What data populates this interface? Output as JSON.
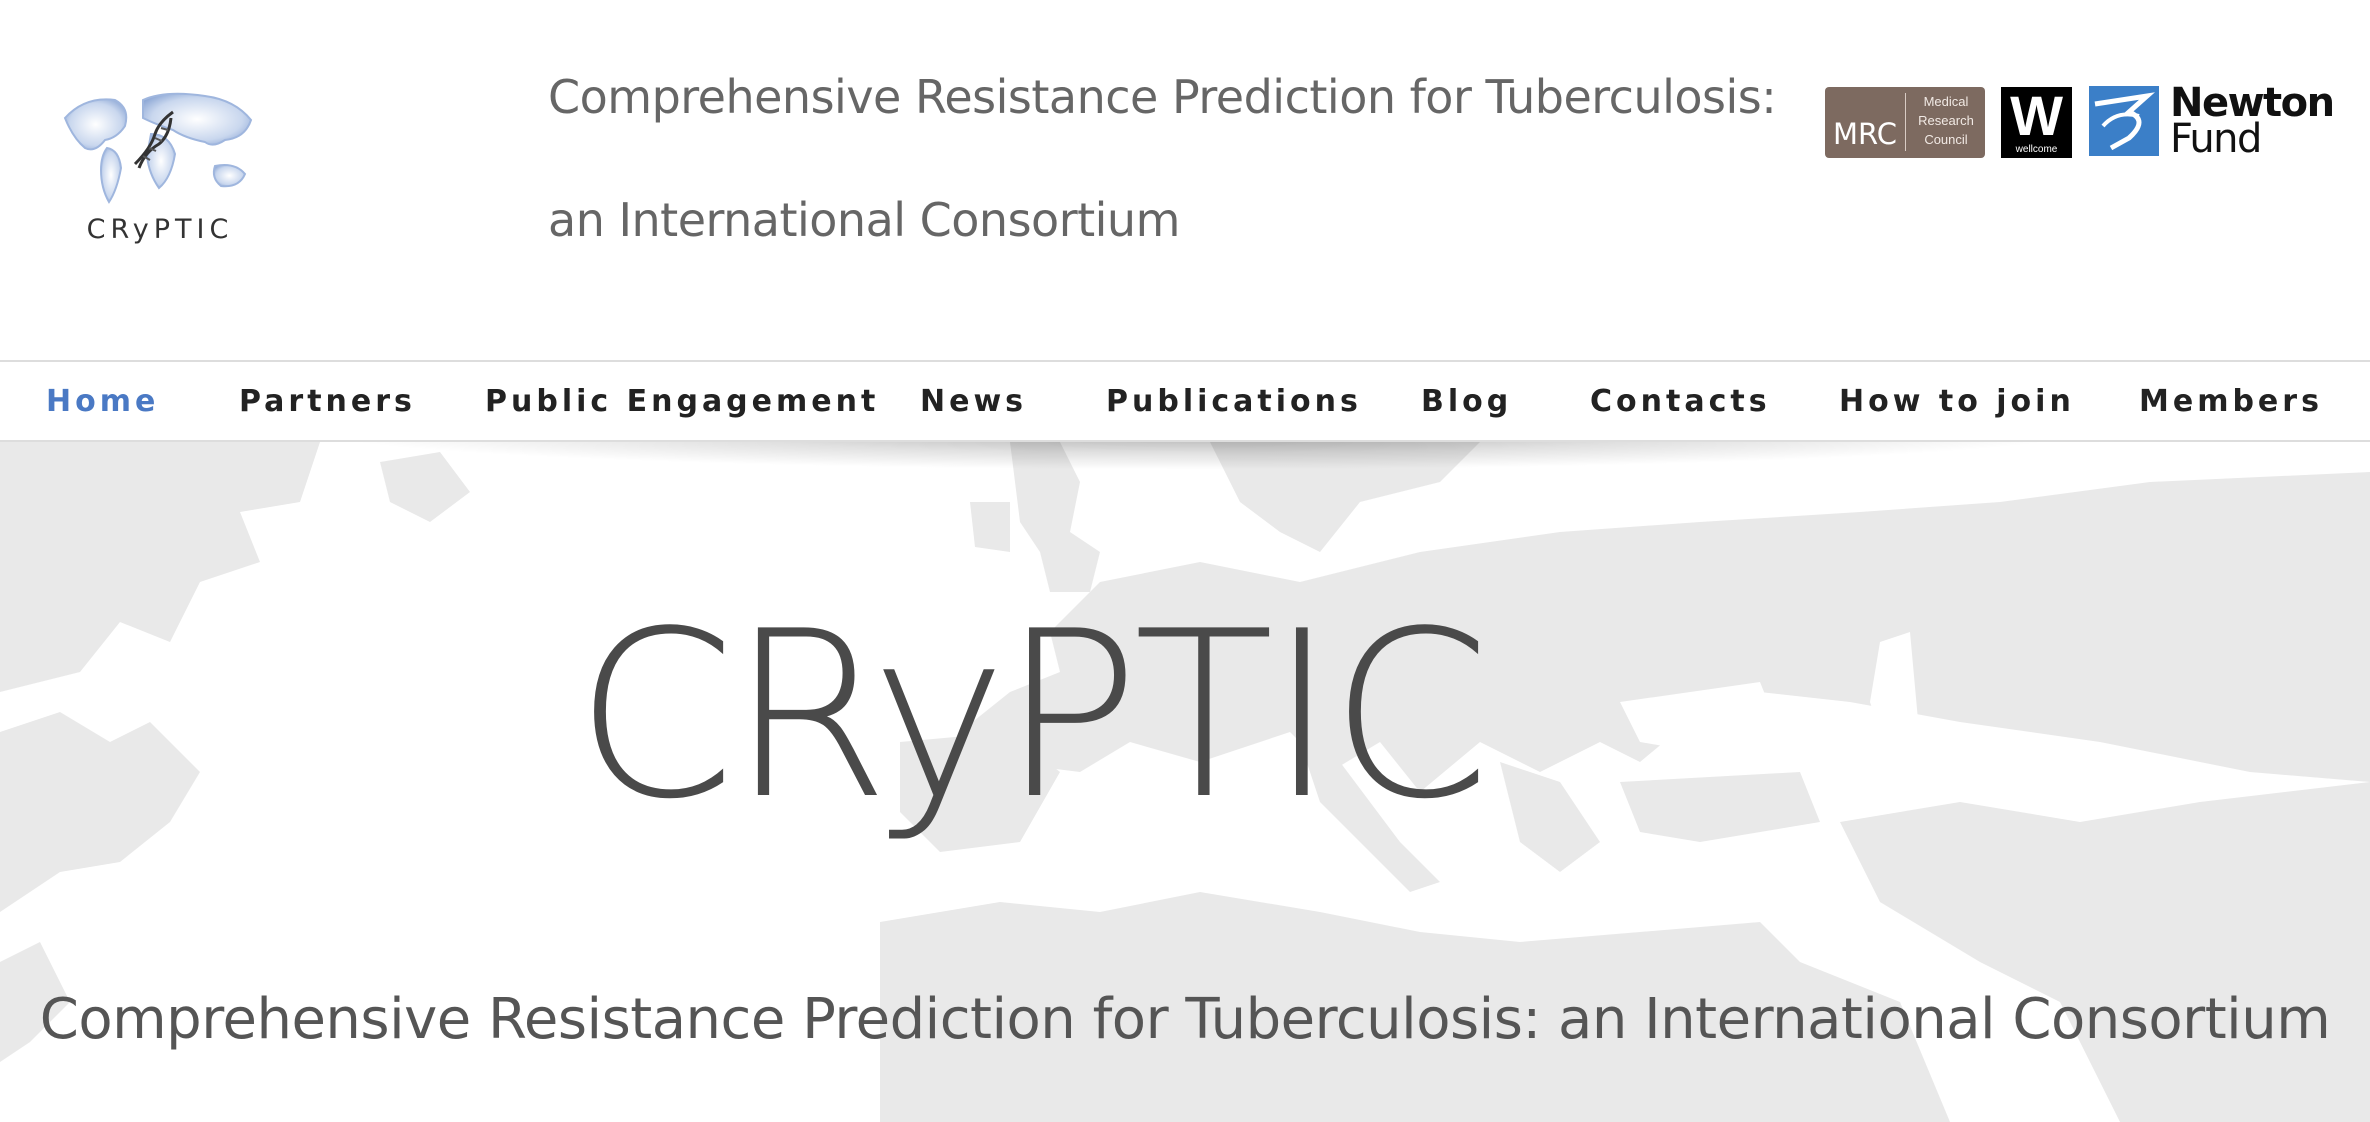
{
  "header": {
    "logo_text": "CRyPTIC",
    "tagline_line1": "Comprehensive Resistance Prediction for Tuberculosis:",
    "tagline_line2": "an International Consortium",
    "sponsors": {
      "mrc_abbr": "MRC",
      "mrc_line1": "Medical",
      "mrc_line2": "Research",
      "mrc_line3": "Council",
      "wellcome_letter": "W",
      "wellcome_name": "wellcome",
      "newton_line1": "Newton",
      "newton_line2": "Fund"
    }
  },
  "nav": {
    "items": [
      {
        "label": "Home",
        "active": true
      },
      {
        "label": "Partners",
        "active": false
      },
      {
        "label": "Public Engagement",
        "active": false
      },
      {
        "label": "News",
        "active": false
      },
      {
        "label": "Publications",
        "active": false
      },
      {
        "label": "Blog",
        "active": false
      },
      {
        "label": "Contacts",
        "active": false
      },
      {
        "label": "How to join",
        "active": false
      },
      {
        "label": "Members",
        "active": false
      }
    ],
    "active_color": "#4a79c4"
  },
  "hero": {
    "title": "CRyPTIC",
    "subtitle": "Comprehensive Resistance Prediction for Tuberculosis: an International Consortium",
    "background": "world-map-europe"
  },
  "colors": {
    "map_land": "#e8e8e8",
    "text_gray": "#666666",
    "mrc_brown": "#7d6a60",
    "newton_blue": "#3b7fc8"
  }
}
